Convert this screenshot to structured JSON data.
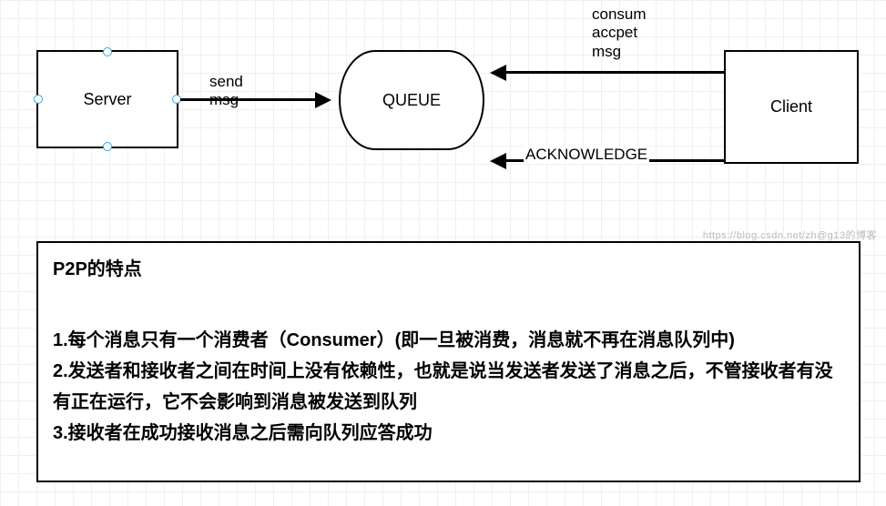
{
  "diagram": {
    "server_label": "Server",
    "queue_label": "QUEUE",
    "client_label": "Client",
    "send_msg_line1": "send",
    "send_msg_line2": "msg",
    "consum_line1": "consum",
    "consum_line2": "accpet",
    "consum_line3": "msg",
    "ack_label": "ACKNOWLEDGE"
  },
  "description": {
    "title": "P2P的特点",
    "item1": "1.每个消息只有一个消费者（Consumer）(即一旦被消费，消息就不再在消息队列中)",
    "item2": "2.发送者和接收者之间在时间上没有依赖性，也就是说当发送者发送了消息之后，不管接收者有没有正在运行，它不会影响到消息被发送到队列",
    "item3": "3.接收者在成功接收消息之后需向队列应答成功"
  },
  "watermark": "https://blog.csdn.net/zh@g13的博客"
}
